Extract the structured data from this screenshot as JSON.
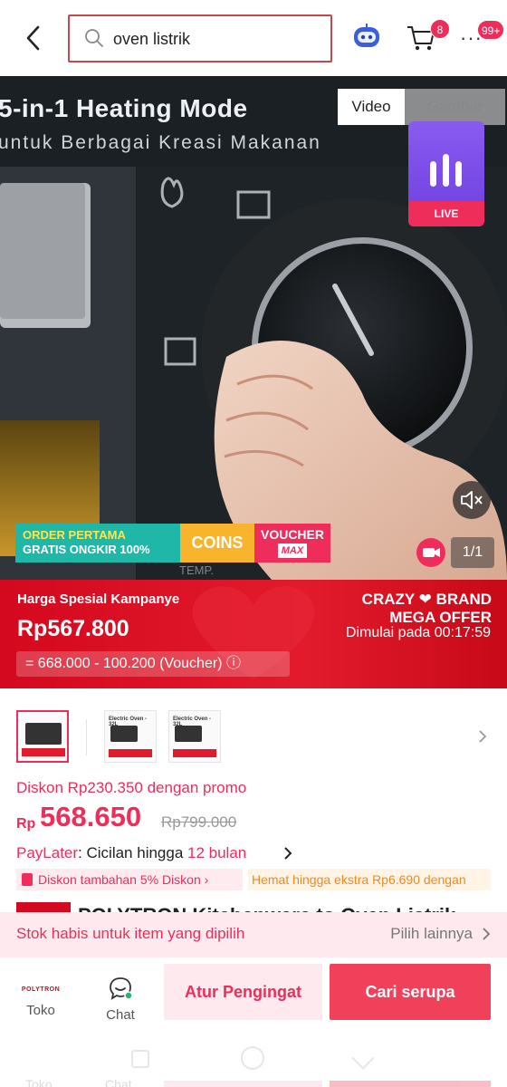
{
  "header": {
    "search_value": "oven listrik",
    "cart_count": "8",
    "notif_count": "99+"
  },
  "media": {
    "headline": "5-in-1 Heating Mode",
    "subline": "untuk Berbagai Kreasi Makanan",
    "tab_video": "Video",
    "tab_image": "Gambar",
    "live_label": "LIVE",
    "promo_line1": "ORDER PERTAMA",
    "promo_line2": "GRATIS ONGKIR 100%",
    "promo_coins": "COINS",
    "promo_voucher": "VOUCHER",
    "promo_max": "MAX",
    "counter": "1/1"
  },
  "campaign": {
    "label": "Harga Spesial Kampanye",
    "price": "Rp567.800",
    "brand_line1": "CRAZY ❤ BRAND",
    "brand_line2": "MEGA OFFER",
    "start_text": "Dimulai pada 00:17:59",
    "calc_text": "= 668.000 - 100.200 (Voucher) ⓘ"
  },
  "product": {
    "thumb_title": "Electric Oven - 32L",
    "discount_text": "Diskon Rp230.350 dengan promo",
    "currency": "Rp",
    "price": "568.650",
    "original_price": "Rp799.000",
    "paylater_label": "PayLater",
    "paylater_text": ": Cicilan hingga ",
    "paylater_highlight": "12 bulan",
    "chip_discount": "Diskon tambahan 5% Diskon ›",
    "chip_saving": "Hemat hingga ekstra Rp6.690 dengan",
    "title_peek": "POLYTRON Kitchenware to Oven Listrik"
  },
  "stock": {
    "message": "Stok habis untuk item yang dipilih",
    "other": "Pilih lainnya"
  },
  "bottom": {
    "store_logo": "POLYTRON",
    "store_label": "Toko",
    "chat_label": "Chat",
    "remind_button": "Atur Pengingat",
    "similar_button": "Cari serupa"
  },
  "colors": {
    "brand_pink": "#ee2d5b",
    "campaign_red": "#d4081e",
    "live_purple": "#7a4be8"
  }
}
